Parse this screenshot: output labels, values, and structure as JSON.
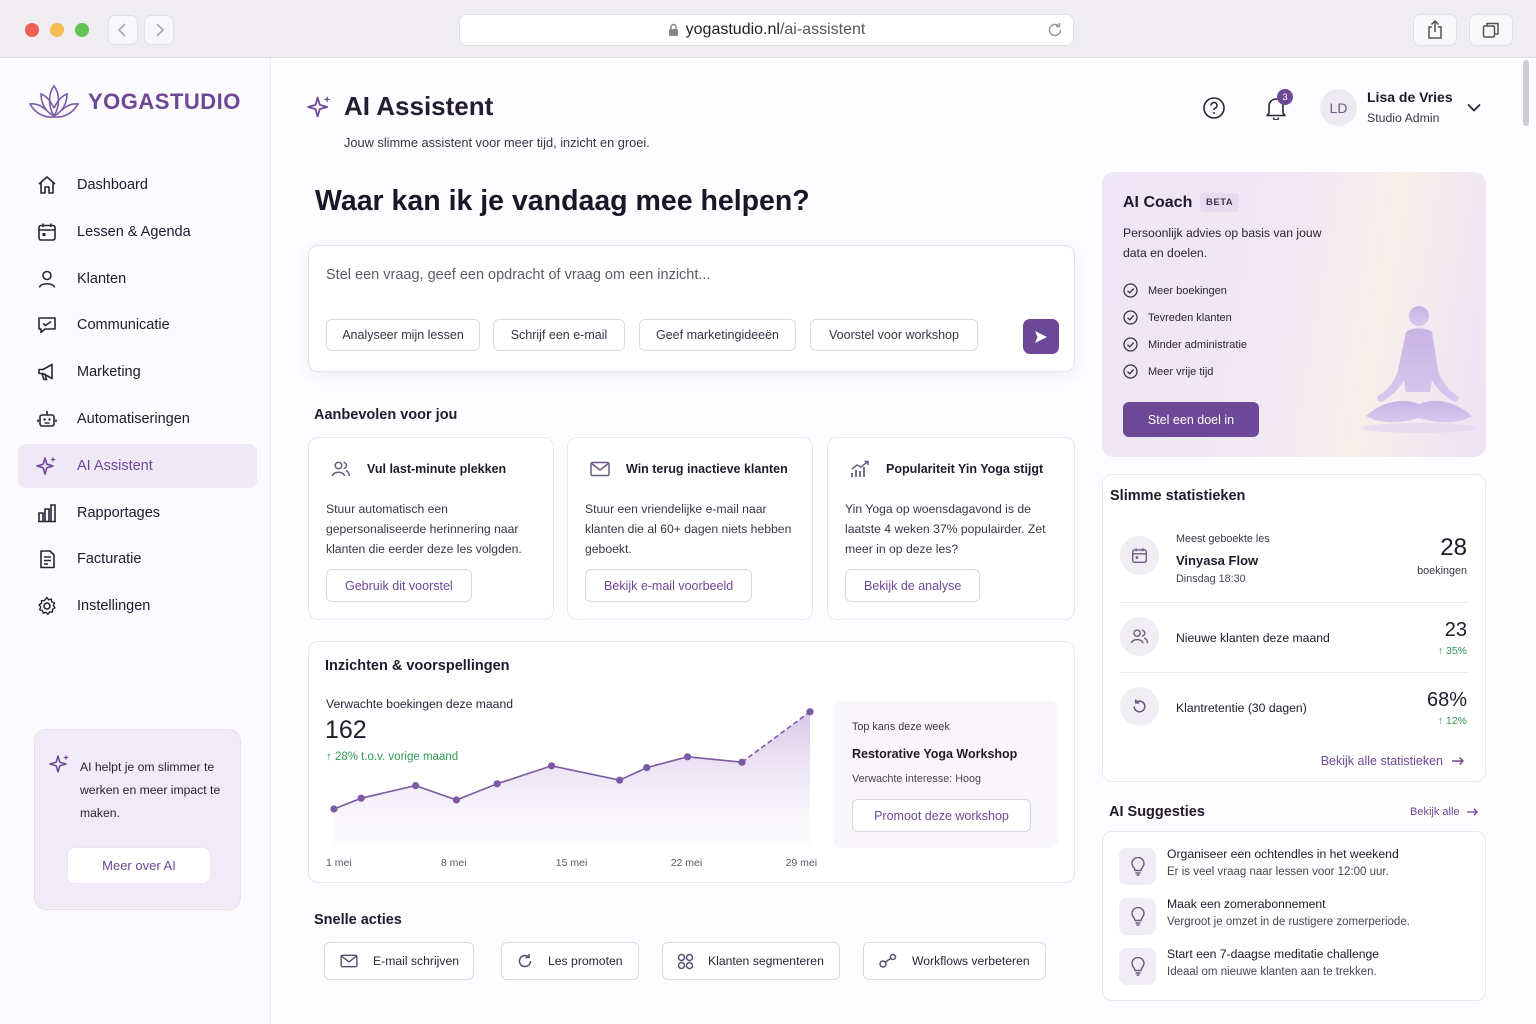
{
  "browser": {
    "url_domain": "yogastudio.nl",
    "url_path": "/ai-assistent"
  },
  "brand": {
    "name": "YOGASTUDIO",
    "accent": "#6d4896"
  },
  "sidebar": {
    "items": [
      {
        "label": "Dashboard",
        "icon": "home-icon"
      },
      {
        "label": "Lessen & Agenda",
        "icon": "calendar-icon"
      },
      {
        "label": "Klanten",
        "icon": "user-icon"
      },
      {
        "label": "Communicatie",
        "icon": "message-icon"
      },
      {
        "label": "Marketing",
        "icon": "megaphone-icon"
      },
      {
        "label": "Automatiseringen",
        "icon": "robot-icon"
      },
      {
        "label": "AI Assistent",
        "icon": "sparkle-icon",
        "active": true
      },
      {
        "label": "Rapportages",
        "icon": "bar-chart-icon"
      },
      {
        "label": "Facturatie",
        "icon": "invoice-icon"
      },
      {
        "label": "Instellingen",
        "icon": "gear-icon"
      }
    ],
    "promo": {
      "text": "AI helpt je om slimmer te werken en meer impact te maken.",
      "button": "Meer over AI"
    }
  },
  "header": {
    "title": "AI Assistent",
    "subtitle": "Jouw slimme assistent voor meer tijd, inzicht en groei.",
    "notifications": "3",
    "user": {
      "initials": "LD",
      "name": "Lisa de Vries",
      "role": "Studio Admin"
    }
  },
  "prompt": {
    "heading": "Waar kan ik je vandaag mee helpen?",
    "placeholder": "Stel een vraag, geef een opdracht of vraag om een inzicht...",
    "chips": [
      "Analyseer mijn lessen",
      "Schrijf een e-mail",
      "Geef marketingideeën",
      "Voorstel voor workshop"
    ]
  },
  "recommended": {
    "heading": "Aanbevolen voor jou",
    "cards": [
      {
        "title": "Vul last-minute plekken",
        "body": "Stuur automatisch een gepersonaliseerde herinnering naar klanten die eerder deze les volgden.",
        "button": "Gebruik dit voorstel",
        "icon": "users-icon"
      },
      {
        "title": "Win terug inactieve klanten",
        "body": "Stuur een vriendelijke e-mail naar klanten die al 60+ dagen niets hebben geboekt.",
        "button": "Bekijk e-mail voorbeeld",
        "icon": "mail-icon"
      },
      {
        "title": "Populariteit Yin Yoga stijgt",
        "body": "Yin Yoga op woensdagavond is de laatste 4 weken 37% populairder. Zet meer in op deze les?",
        "button": "Bekijk de analyse",
        "icon": "trend-up-icon"
      }
    ]
  },
  "insights": {
    "heading": "Inzichten & voorspellingen",
    "label": "Verwachte boekingen deze maand",
    "value": "162",
    "change": "↑ 28% t.o.v. vorige maand",
    "top": {
      "label": "Top kans deze week",
      "name": "Restorative Yoga Workshop",
      "interest": "Verwachte interesse: Hoog",
      "button": "Promoot deze workshop"
    }
  },
  "chart_data": {
    "type": "area",
    "x_ticks": [
      "1 mei",
      "8 mei",
      "15 mei",
      "22 mei",
      "29 mei"
    ],
    "x": [
      1,
      3,
      7,
      10,
      13,
      17,
      22,
      24,
      27,
      31,
      36
    ],
    "values": [
      40,
      52,
      66,
      50,
      68,
      88,
      72,
      86,
      98,
      92,
      148
    ],
    "ylim": [
      0,
      170
    ],
    "line_color": "#7c5aa3",
    "grid": false
  },
  "quick_actions": {
    "heading": "Snelle acties",
    "items": [
      {
        "label": "E-mail schrijven",
        "icon": "mail-icon"
      },
      {
        "label": "Les promoten",
        "icon": "refresh-icon"
      },
      {
        "label": "Klanten segmenteren",
        "icon": "segment-icon"
      },
      {
        "label": "Workflows verbeteren",
        "icon": "workflow-icon"
      }
    ]
  },
  "coach": {
    "title": "AI Coach",
    "badge": "BETA",
    "desc": "Persoonlijk advies op basis van jouw data en doelen.",
    "items": [
      "Meer boekingen",
      "Tevreden klanten",
      "Minder administratie",
      "Meer vrije tijd"
    ],
    "button": "Stel een doel in"
  },
  "stats": {
    "heading": "Slimme statistieken",
    "top_label": "Meest geboekte les",
    "top_name": "Vinyasa Flow",
    "top_when": "Dinsdag 18:30",
    "top_value": "28",
    "top_unit": "boekingen",
    "new_label": "Nieuwe klanten deze maand",
    "new_value": "23",
    "new_change": "↑ 35%",
    "ret_label": "Klantretentie (30 dagen)",
    "ret_value": "68%",
    "ret_change": "↑ 12%",
    "link": "Bekijk alle statistieken"
  },
  "suggestions": {
    "heading": "AI Suggesties",
    "link": "Bekijk alle",
    "items": [
      {
        "title": "Organiseer een ochtendles in het weekend",
        "sub": "Er is veel vraag naar lessen voor 12:00 uur."
      },
      {
        "title": "Maak een zomerabonnement",
        "sub": "Vergroot je omzet in de rustigere zomerperiode."
      },
      {
        "title": "Start een 7-daagse meditatie challenge",
        "sub": "Ideaal om nieuwe klanten aan te trekken."
      }
    ]
  }
}
